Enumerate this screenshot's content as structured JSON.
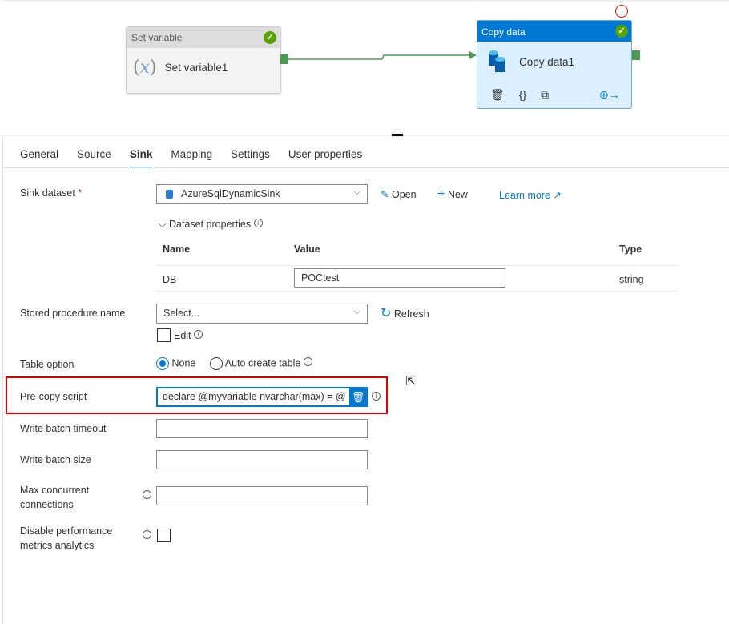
{
  "pipeline": {
    "set_variable": {
      "header": "Set variable",
      "name": "Set variable1",
      "icon": "variable-icon"
    },
    "copy_data": {
      "header": "Copy data",
      "name": "Copy data1",
      "icon": "database-icon"
    }
  },
  "tabs": [
    "General",
    "Source",
    "Sink",
    "Mapping",
    "Settings",
    "User properties"
  ],
  "active_tab": "Sink",
  "sink": {
    "dataset_label": "Sink dataset",
    "required": "*",
    "dataset_value": "AzureSqlDynamicSink",
    "open": "Open",
    "new": "New",
    "learn_more": "Learn more",
    "dataset_properties": "Dataset properties",
    "columns": [
      "Name",
      "Value",
      "Type"
    ],
    "rows": [
      {
        "name": "DB",
        "value": "POCtest",
        "type": "string"
      }
    ],
    "sp_label": "Stored procedure name",
    "sp_value": "Select...",
    "refresh": "Refresh",
    "edit": "Edit",
    "table_option_label": "Table option",
    "opt_none": "None",
    "opt_auto": "Auto create table",
    "precopy_label": "Pre-copy script",
    "precopy_value": "declare @myvariable nvarchar(max) = @",
    "wbt_label": "Write batch timeout",
    "wbs_label": "Write batch size",
    "mcc_label": "Max concurrent connections",
    "dpm_label": "Disable performance metrics analytics"
  },
  "colors": {
    "accent": "#0078d4",
    "success": "#57a300",
    "highlight": "#e00000"
  }
}
